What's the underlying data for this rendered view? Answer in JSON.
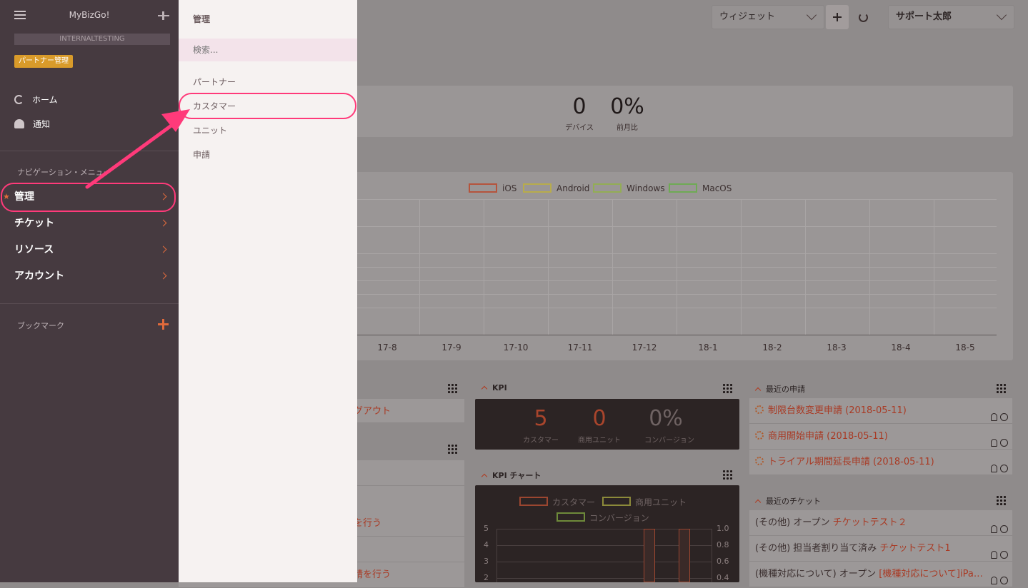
{
  "sidebar": {
    "app_title": "MyBizGo!",
    "org_name": "INTERNALTESTING",
    "role_badge": "パートナー管理",
    "links": [
      {
        "label": "ホーム",
        "icon": "home-icon"
      },
      {
        "label": "通知",
        "icon": "bell-icon"
      }
    ],
    "nav_section": "ナビゲーション・メニュー",
    "nav_items": [
      {
        "label": "管理",
        "starred": true
      },
      {
        "label": "チケット"
      },
      {
        "label": "リソース"
      },
      {
        "label": "アカウント"
      }
    ],
    "bookmark_section": "ブックマーク"
  },
  "flyout": {
    "title": "管理",
    "search_placeholder": "検索...",
    "items": [
      "パートナー",
      "カスタマー",
      "ユニット",
      "申請"
    ]
  },
  "topbar": {
    "widget_select": "ウィジェット",
    "user_select": "サポート太郎"
  },
  "summary": {
    "devices_value": "0",
    "devices_label": "デバイス",
    "mom_value": "0%",
    "mom_label": "前月比"
  },
  "device_chart": {
    "legend": [
      "iOS",
      "Android",
      "Windows",
      "MacOS"
    ],
    "x_ticks": [
      "17-8",
      "17-9",
      "17-10",
      "17-11",
      "17-12",
      "18-1",
      "18-2",
      "18-3",
      "18-4",
      "18-5"
    ]
  },
  "left_panel": {
    "text1": "グアウト",
    "text2": "を行う",
    "text3": "請を行う"
  },
  "kpi": {
    "title": "KPI",
    "values": [
      {
        "value": "5",
        "label": "カスタマー"
      },
      {
        "value": "0",
        "label": "商用ユニット"
      },
      {
        "value": "0%",
        "label": "コンバージョン"
      }
    ]
  },
  "kpi_chart": {
    "title": "KPI チャート",
    "legend": [
      "カスタマー",
      "商用ユニット",
      "コンバージョン"
    ],
    "y_left": [
      "5",
      "4",
      "3",
      "2"
    ],
    "y_right": [
      "1.0",
      "0.8",
      "0.6",
      "0.4"
    ]
  },
  "recent_requests": {
    "title": "最近の申請",
    "items": [
      "制限台数変更申請 (2018-05-11)",
      "商用開始申請 (2018-05-11)",
      "トライアル期間延長申請 (2018-05-11)"
    ]
  },
  "recent_tickets": {
    "title": "最近のチケット",
    "items": [
      {
        "prefix": "(その他) オープン",
        "link": "チケットテスト２"
      },
      {
        "prefix": "(その他) 担当者割り当て済み",
        "link": "チケットテスト1"
      },
      {
        "prefix": "(機種対応について) オープン",
        "link": "[機種対応について]iPa…"
      }
    ]
  },
  "colors": {
    "sidebar_bg": "#463a40",
    "flyout_bg": "#f6f2f1",
    "accent_orange": "#e06a3b",
    "highlight_pink": "#ff3a7a",
    "badge_yellow": "#d99b2a"
  }
}
